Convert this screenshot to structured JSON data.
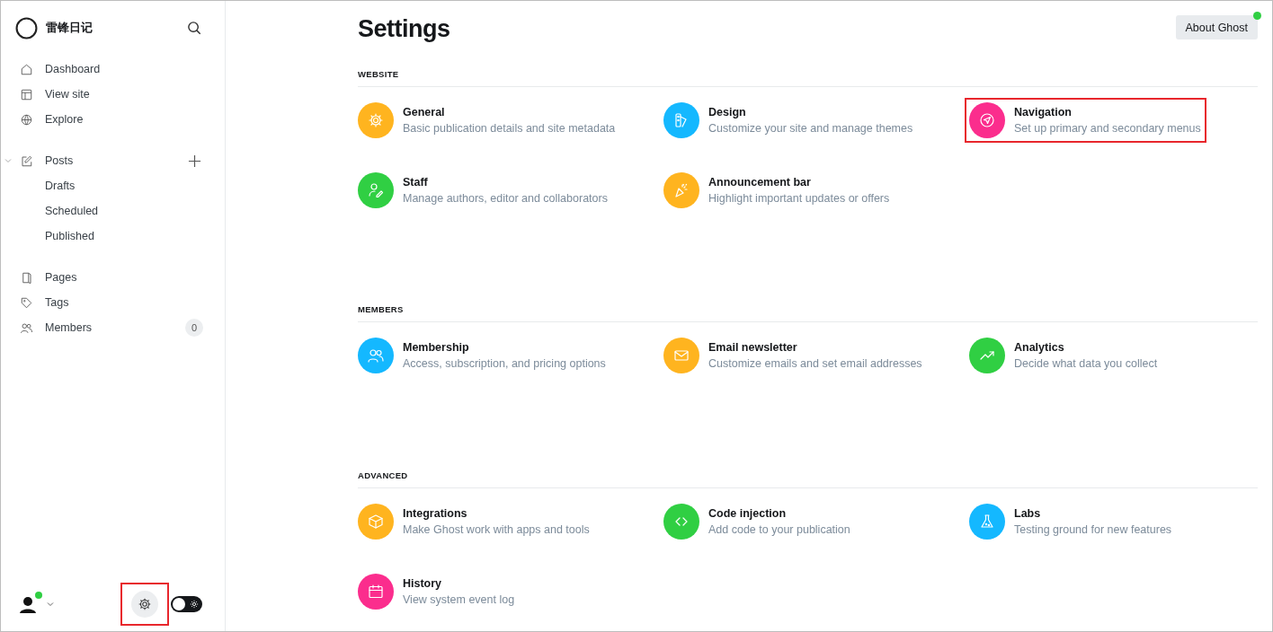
{
  "sidebar": {
    "site_name": "雷锋日记",
    "groups": [
      {
        "items": [
          {
            "label": "Dashboard"
          },
          {
            "label": "View site"
          },
          {
            "label": "Explore"
          }
        ]
      },
      {
        "items": [
          {
            "label": "Posts",
            "expanded": true,
            "children": [
              {
                "label": "Drafts"
              },
              {
                "label": "Scheduled"
              },
              {
                "label": "Published"
              }
            ]
          }
        ]
      },
      {
        "items": [
          {
            "label": "Pages"
          },
          {
            "label": "Tags"
          },
          {
            "label": "Members",
            "count": "0"
          }
        ]
      }
    ],
    "footer": {
      "online": true,
      "settings_highlighted": true,
      "theme_toggle": {
        "on": false
      }
    }
  },
  "page": {
    "title": "Settings",
    "about_button": "About Ghost",
    "update_dot": true,
    "sections": [
      {
        "heading": "WEBSITE",
        "items": [
          {
            "title": "General",
            "description": "Basic publication details and site metadata",
            "color": "#ffb41f",
            "highlighted": false
          },
          {
            "title": "Design",
            "description": "Customize your site and manage themes",
            "color": "#14b8ff",
            "highlighted": false
          },
          {
            "title": "Navigation",
            "description": "Set up primary and secondary menus",
            "color": "#fb2d8d",
            "highlighted": true
          },
          {
            "title": "Staff",
            "description": "Manage authors, editor and collaborators",
            "color": "#30cf43",
            "highlighted": false
          },
          {
            "title": "Announcement bar",
            "description": "Highlight important updates or offers",
            "color": "#ffb41f",
            "highlighted": false
          }
        ]
      },
      {
        "heading": "MEMBERS",
        "items": [
          {
            "title": "Membership",
            "description": "Access, subscription, and pricing options",
            "color": "#14b8ff",
            "highlighted": false
          },
          {
            "title": "Email newsletter",
            "description": "Customize emails and set email addresses",
            "color": "#ffb41f",
            "highlighted": false
          },
          {
            "title": "Analytics",
            "description": "Decide what data you collect",
            "color": "#30cf43",
            "highlighted": false
          }
        ]
      },
      {
        "heading": "ADVANCED",
        "items": [
          {
            "title": "Integrations",
            "description": "Make Ghost work with apps and tools",
            "color": "#ffb41f",
            "highlighted": false
          },
          {
            "title": "Code injection",
            "description": "Add code to your publication",
            "color": "#30cf43",
            "highlighted": false
          },
          {
            "title": "Labs",
            "description": "Testing ground for new features",
            "color": "#14b8ff",
            "highlighted": false
          },
          {
            "title": "History",
            "description": "View system event log",
            "color": "#fb2d8d",
            "highlighted": false
          }
        ]
      }
    ]
  }
}
